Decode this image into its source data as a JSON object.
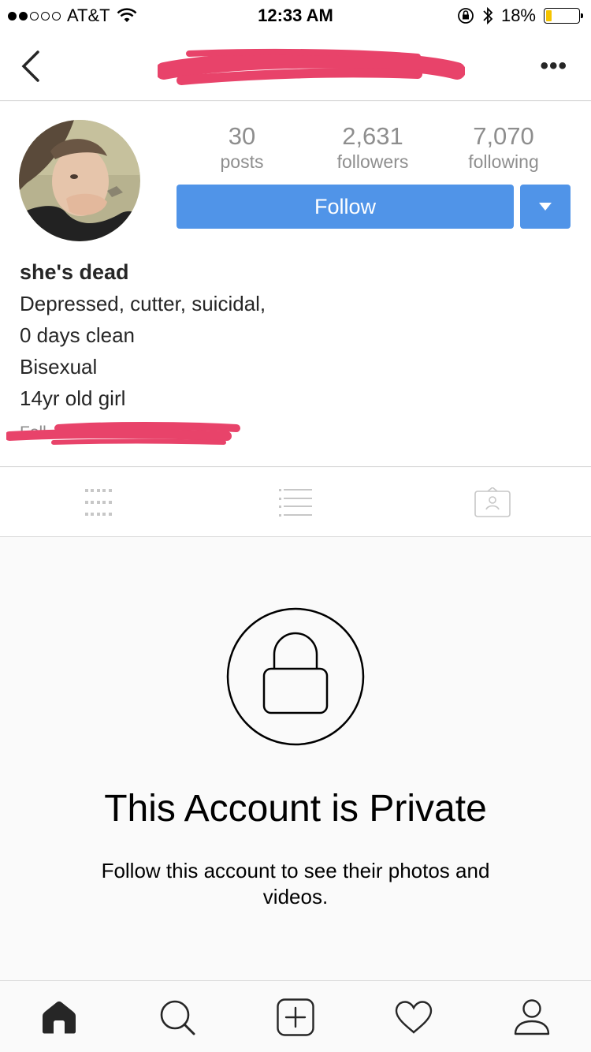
{
  "status_bar": {
    "carrier": "AT&T",
    "time": "12:33 AM",
    "battery_percent": "18%",
    "battery_level": 0.18,
    "signal_bars": 2,
    "icons": [
      "wifi-icon",
      "orientation-lock-icon",
      "bluetooth-icon",
      "battery-icon"
    ]
  },
  "nav": {
    "back_icon": "chevron-left-icon",
    "more_label": "•••"
  },
  "profile": {
    "stats": [
      {
        "value": "30",
        "label": "posts"
      },
      {
        "value": "2,631",
        "label": "followers"
      },
      {
        "value": "7,070",
        "label": "following"
      }
    ],
    "follow_label": "Follow",
    "name": "she's dead",
    "bio_lines": [
      "Depressed, cutter, suicidal,",
      "0 days clean",
      "Bisexual",
      "14yr old girl"
    ],
    "followed_by_stub": "Foll"
  },
  "tabs": [
    {
      "name": "tab-grid",
      "icon": "grid-icon"
    },
    {
      "name": "tab-list",
      "icon": "list-icon"
    },
    {
      "name": "tab-tagged",
      "icon": "tagged-icon"
    }
  ],
  "private": {
    "title": "This Account is Private",
    "subtitle": "Follow this account to see their photos and videos."
  },
  "bottom_nav": [
    {
      "name": "home",
      "icon": "home-icon"
    },
    {
      "name": "search",
      "icon": "search-icon"
    },
    {
      "name": "add",
      "icon": "add-post-icon"
    },
    {
      "name": "activity",
      "icon": "heart-icon"
    },
    {
      "name": "profile",
      "icon": "profile-icon"
    }
  ],
  "colors": {
    "accent": "#5094e8",
    "redaction": "#e8436a",
    "battery": "#f5c400"
  }
}
